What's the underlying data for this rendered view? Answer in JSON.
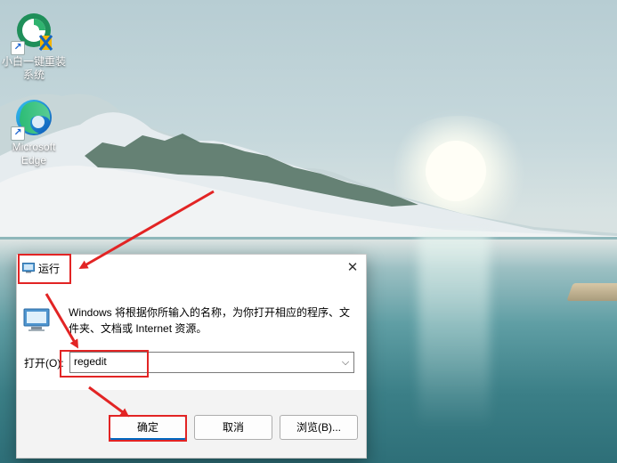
{
  "desktop": {
    "icons": [
      {
        "label_line1": "小白一键重装",
        "label_line2": "系统",
        "icon": "xiaobai-reinstall-icon"
      },
      {
        "label_line1": "Microsoft",
        "label_line2": "Edge",
        "icon": "edge-browser-icon"
      }
    ]
  },
  "run_dialog": {
    "title": "运行",
    "description": "Windows 将根据你所输入的名称，为你打开相应的程序、文件夹、文档或 Internet 资源。",
    "open_label": "打开(O):",
    "input_value": "regedit",
    "buttons": {
      "ok": "确定",
      "cancel": "取消",
      "browse": "浏览(B)..."
    },
    "close_glyph": "✕"
  },
  "colors": {
    "annotation_red": "#e22424",
    "ok_button_border": "#0067c0"
  }
}
